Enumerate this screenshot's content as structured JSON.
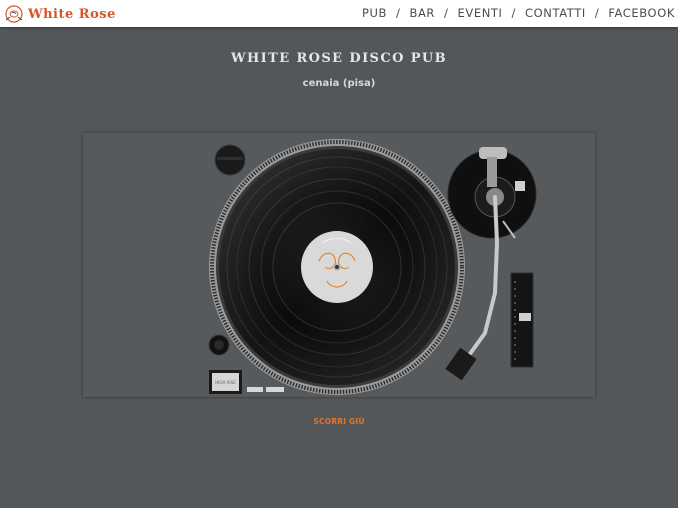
{
  "brand": {
    "name": "White Rose",
    "accent": "#d5562a"
  },
  "nav": [
    {
      "label": "PUB"
    },
    {
      "label": "BAR"
    },
    {
      "label": "EVENTI"
    },
    {
      "label": "CONTATTI"
    },
    {
      "label": "FACEBOOK"
    }
  ],
  "nav_separator": "/",
  "hero": {
    "title": "WHITE ROSE DISCO PUB",
    "subtitle": "cenaia (pisa)"
  },
  "deck_label": "HIGH RISE",
  "scroll": {
    "label": "SCORRI GIÙ",
    "color": "#e0752a"
  },
  "colors": {
    "background": "#54575a",
    "topbar": "#ffffff",
    "nav_text": "#4a4d50"
  }
}
